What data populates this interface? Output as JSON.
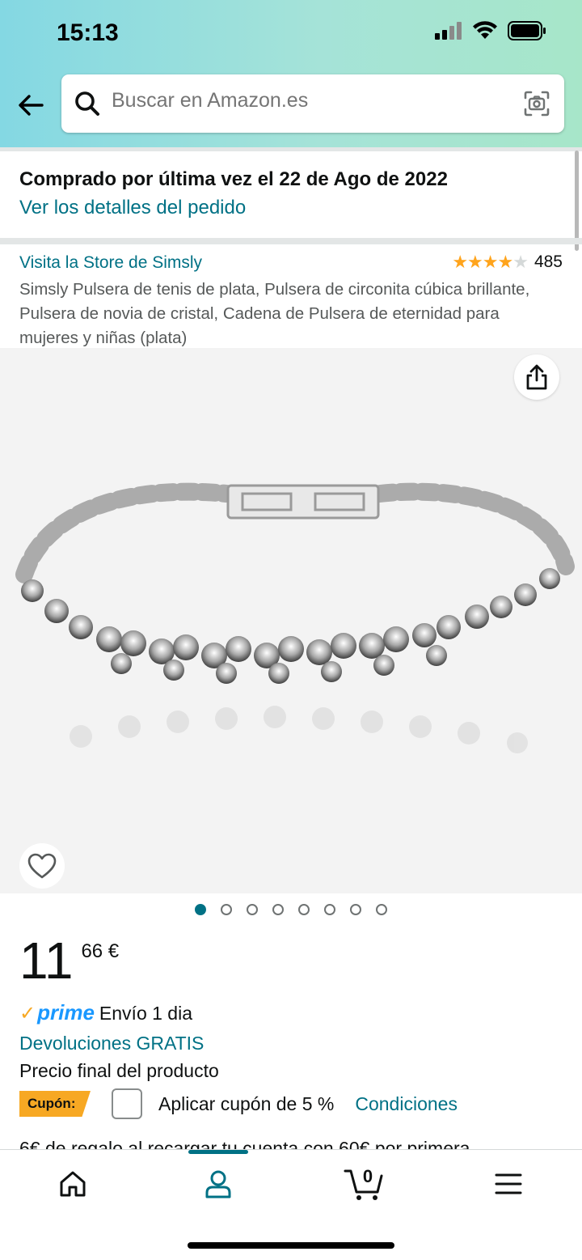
{
  "status_bar": {
    "time": "15:13"
  },
  "search": {
    "placeholder": "Buscar en Amazon.es"
  },
  "order": {
    "title": "Comprado por última vez el 22 de Ago de 2022",
    "details_link": "Ver los detalles del pedido"
  },
  "product": {
    "store_link": "Visita la Store de Simsly",
    "rating_stars": 4,
    "rating_count": "485",
    "title": "Simsly Pulsera de tenis de plata, Pulsera de circonita cúbica brillante, Pulsera de novia de cristal, Cadena de Pulsera de eternidad para mujeres y niñas (plata)",
    "image_count": 8,
    "image_active_index": 0
  },
  "price": {
    "whole": "11",
    "fraction": "66 €"
  },
  "delivery": {
    "prime_logo": "prime",
    "text": "Envío 1 dia"
  },
  "returns_link": "Devoluciones GRATIS",
  "final_price_text": "Precio final del producto",
  "coupon": {
    "badge": "Cupón:",
    "text": "Aplicar cupón de 5 %",
    "conditions_link": "Condiciones"
  },
  "truncated_text": "6€ de regalo al recargar tu cuenta con 60€ por primera",
  "tabbar": {
    "cart_count": "0",
    "icons": [
      "home-icon",
      "account-icon",
      "cart-icon",
      "menu-icon"
    ]
  },
  "colors": {
    "link": "#007185",
    "accent": "#f7a823",
    "prime": "#1a98ff"
  }
}
